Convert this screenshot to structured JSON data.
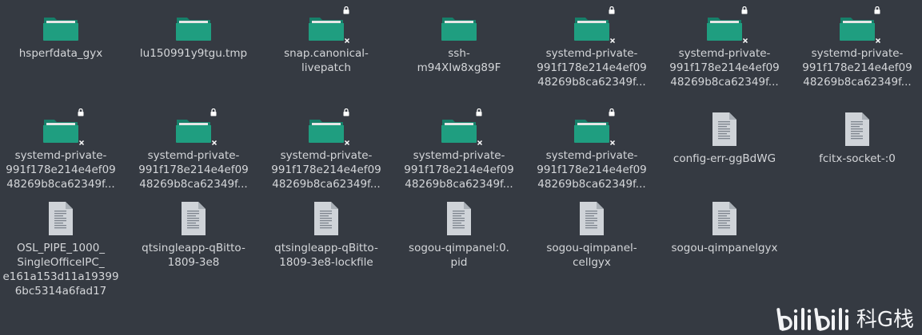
{
  "items": [
    {
      "type": "folder",
      "lines": [
        "hsperfdata_gyx"
      ],
      "locked": false
    },
    {
      "type": "folder",
      "lines": [
        "lu150991y9tgu.tmp"
      ],
      "locked": false
    },
    {
      "type": "folder",
      "lines": [
        "snap.canonical-",
        "livepatch"
      ],
      "locked": true
    },
    {
      "type": "folder",
      "lines": [
        "ssh-",
        "m94XIw8xg89F"
      ],
      "locked": false
    },
    {
      "type": "folder",
      "lines": [
        "systemd-private-",
        "991f178e214e4ef09",
        "48269b8ca62349f..."
      ],
      "locked": true
    },
    {
      "type": "folder",
      "lines": [
        "systemd-private-",
        "991f178e214e4ef09",
        "48269b8ca62349f..."
      ],
      "locked": true
    },
    {
      "type": "folder",
      "lines": [
        "systemd-private-",
        "991f178e214e4ef09",
        "48269b8ca62349f..."
      ],
      "locked": true
    },
    {
      "type": "folder",
      "lines": [
        "systemd-private-",
        "991f178e214e4ef09",
        "48269b8ca62349f..."
      ],
      "locked": true
    },
    {
      "type": "folder",
      "lines": [
        "systemd-private-",
        "991f178e214e4ef09",
        "48269b8ca62349f..."
      ],
      "locked": true
    },
    {
      "type": "folder",
      "lines": [
        "systemd-private-",
        "991f178e214e4ef09",
        "48269b8ca62349f..."
      ],
      "locked": true
    },
    {
      "type": "folder",
      "lines": [
        "systemd-private-",
        "991f178e214e4ef09",
        "48269b8ca62349f..."
      ],
      "locked": true
    },
    {
      "type": "folder",
      "lines": [
        "systemd-private-",
        "991f178e214e4ef09",
        "48269b8ca62349f..."
      ],
      "locked": true
    },
    {
      "type": "file",
      "lines": [
        "config-err-ggBdWG"
      ],
      "locked": false
    },
    {
      "type": "file",
      "lines": [
        "fcitx-socket-:0"
      ],
      "locked": false
    },
    {
      "type": "file",
      "lines": [
        "OSL_PIPE_1000_",
        "SingleOfficeIPC_",
        "e161a153d11a19399",
        "6bc5314a6fad17"
      ],
      "locked": false
    },
    {
      "type": "file",
      "lines": [
        "qtsingleapp-qBitto-",
        "1809-3e8"
      ],
      "locked": false
    },
    {
      "type": "file",
      "lines": [
        "qtsingleapp-qBitto-",
        "1809-3e8-lockfile"
      ],
      "locked": false
    },
    {
      "type": "file",
      "lines": [
        "sogou-qimpanel:0.",
        "pid"
      ],
      "locked": false
    },
    {
      "type": "file",
      "lines": [
        "sogou-qimpanel-",
        "cellgyx"
      ],
      "locked": false
    },
    {
      "type": "file",
      "lines": [
        "sogou-qimpanelgyx"
      ],
      "locked": false
    }
  ],
  "icons": {
    "folder": "folder-icon",
    "file": "text-file-icon",
    "lock": "lock-icon",
    "no_write": "x-icon"
  },
  "colors": {
    "background": "#353a42",
    "folder_front": "#1f9e80",
    "folder_back": "#17806a",
    "folder_paper": "#e6e6e6",
    "file_body": "#cfd3d8",
    "label": "#d4d6d9"
  },
  "watermark": {
    "logo": "bilibili",
    "text": "科G栈"
  }
}
